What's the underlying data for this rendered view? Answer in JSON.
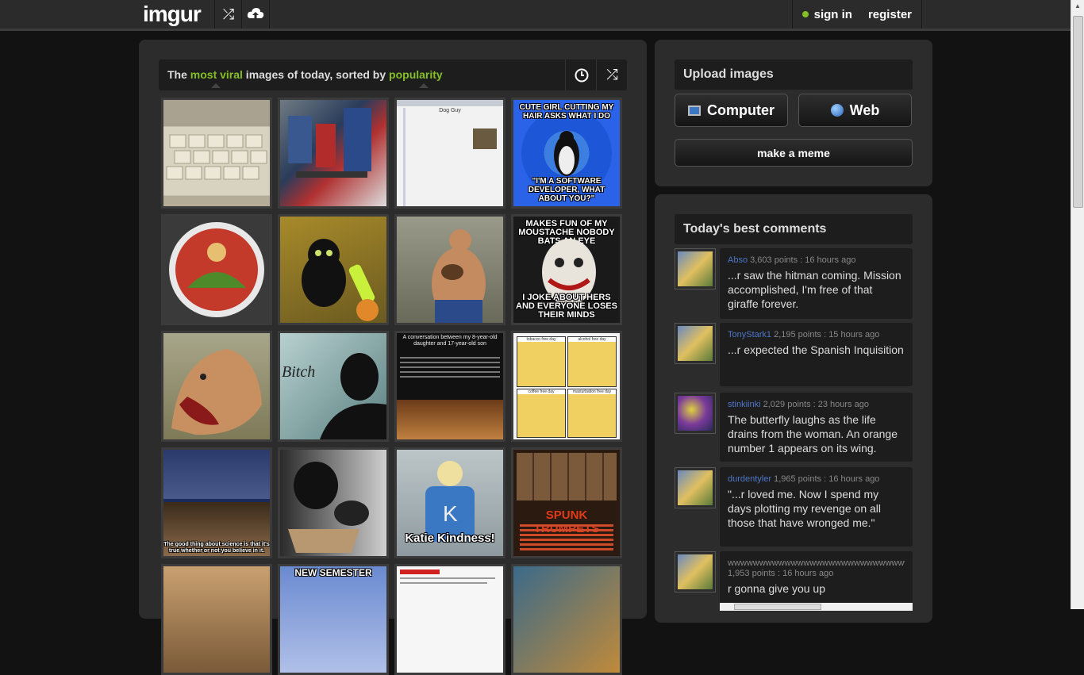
{
  "header": {
    "logo": "imgur",
    "random_icon": "shuffle-icon",
    "upload_icon": "cloud-upload-icon",
    "sign_in": "sign in",
    "register": "register",
    "accent": "#85bf25"
  },
  "gallery": {
    "title_parts": [
      "The ",
      "most viral",
      " images of today, sorted by ",
      "popularity"
    ],
    "time_icon": "clock-icon",
    "random_icon": "shuffle-icon",
    "captions": {
      "penguin_top": "CUTE GIRL CUTTING MY HAIR ASKS WHAT I DO",
      "penguin_bottom": "\"I'M A SOFTWARE DEVELOPER, WHAT ABOUT YOU?\"",
      "joker_top": "MAKES FUN OF MY MOUSTACHE NOBODY BATS AN EYE",
      "joker_bottom": "I JOKE ABOUT HERS AND EVERYONE LOSES THEIR MINDS",
      "bitch": "Bitch",
      "conversation": "A conversation between my 8-year-old daughter and 17-year-old son",
      "katie": "Katie Kindness!",
      "new_semester": "NEW SEMESTER",
      "tyson": "The good thing about science is that it's true whether or not you believe in it.",
      "phone_header": "Dog Guy",
      "spunk": "SPUNK TRUMPETS",
      "lazy_day_1": "tobacco free day",
      "lazy_day_2": "alcohol free day",
      "lazy_day_3": "coffee free day",
      "lazy_day_4": "masturbation free day"
    }
  },
  "upload": {
    "heading": "Upload images",
    "computer": "Computer",
    "web": "Web",
    "make_meme": "make a meme"
  },
  "comments": {
    "heading": "Today's best comments",
    "items": [
      {
        "user": "Abso",
        "meta": " 3,603 points : 16 hours ago",
        "text": "...r saw the hitman coming. Mission accomplished, I'm free of that giraffe forever."
      },
      {
        "user": "TonyStark1",
        "meta": " 2,195 points : 15 hours ago",
        "text": "...r expected the Spanish Inquisition"
      },
      {
        "user": "stinkiinki",
        "meta": " 2,029 points : 23 hours ago",
        "text": "The butterfly laughs as the life drains from the woman. An orange number 1 appears on its wing."
      },
      {
        "user": "durdentyler",
        "meta": " 1,965 points : 16 hours ago",
        "text": "\"...r loved me. Now I spend my days plotting my revenge on all those that have wronged me.\""
      },
      {
        "user": "wwwwwwwwwwwwwwwwwwwwwwwwwwwwwwwwwwwww",
        "meta": "1,953 points : 16 hours ago",
        "text": "r gonna give you up"
      }
    ]
  }
}
